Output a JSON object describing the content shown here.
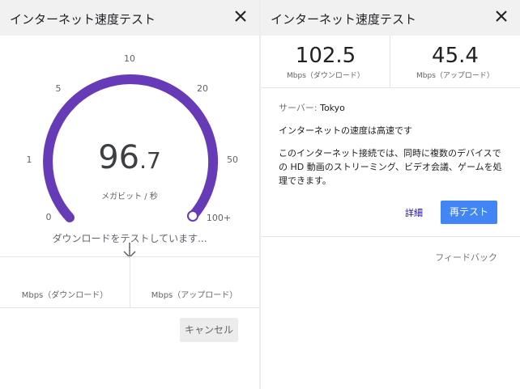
{
  "speedtest_running": {
    "title": "インターネット速度テスト",
    "gauge": {
      "ticks": [
        "0",
        "1",
        "5",
        "10",
        "20",
        "50",
        "100+"
      ],
      "value_int": "96",
      "value_dec": ".7",
      "value": 96.7,
      "unit": "メガビット / 秒",
      "arc_color": "#673ab7"
    },
    "status": "ダウンロードをテストしています...",
    "download_label": "Mbps（ダウンロード）",
    "upload_label": "Mbps（アップロード）",
    "cancel_label": "キャンセル"
  },
  "speedtest_result": {
    "title": "インターネット速度テスト",
    "download_value": "102.5",
    "download_unit": "Mbps（ダウンロード）",
    "upload_value": "45.4",
    "upload_unit": "Mbps（アップロード）",
    "server_label": "サーバー: ",
    "server_name": "Tokyo",
    "speed_message": "インターネットの速度は高速です",
    "description": "このインターネット接続では、同時に複数のデバイスでの HD 動画のストリーミング、ビデオ会議、ゲームを処理できます。",
    "details_label": "詳細",
    "retest_label": "再テスト",
    "feedback_label": "フィードバック",
    "accent_color": "#4285f4"
  }
}
